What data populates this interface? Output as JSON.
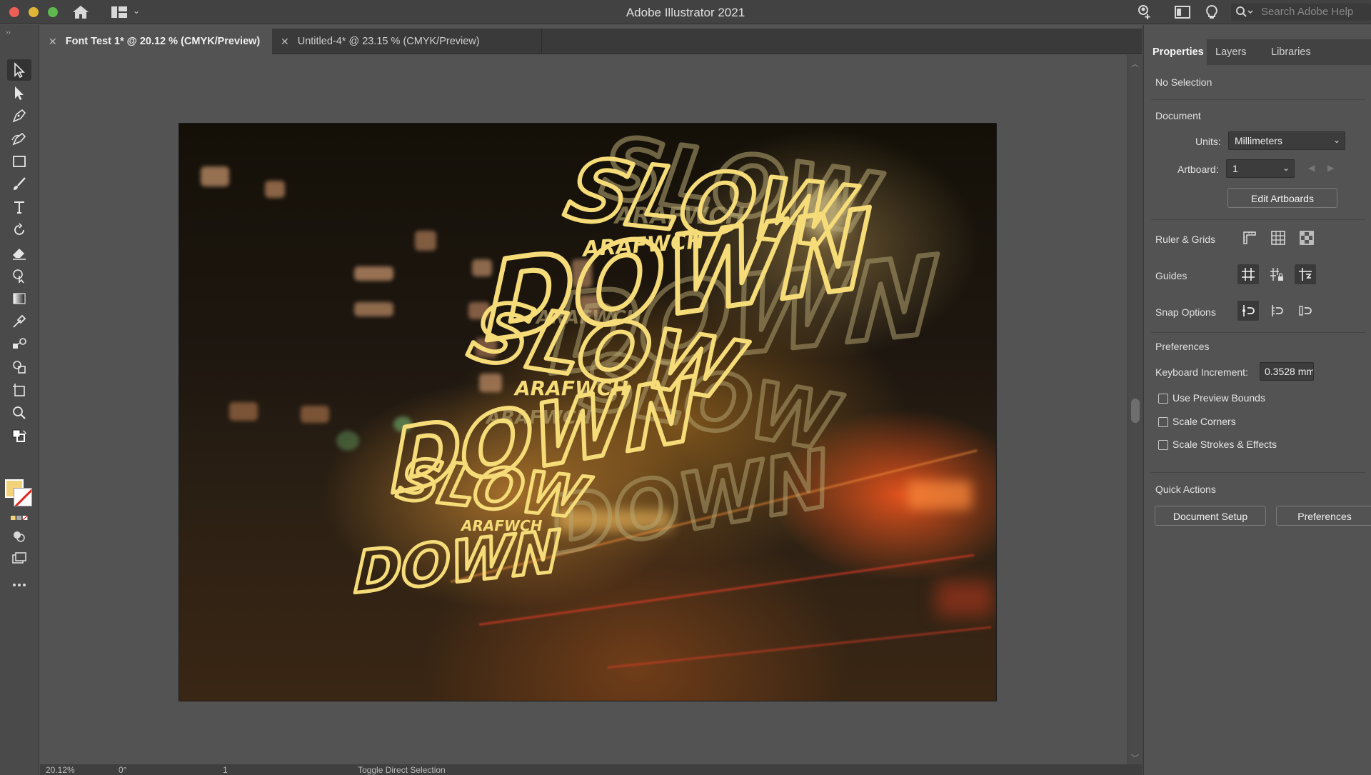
{
  "window": {
    "title": "Adobe Illustrator 2021"
  },
  "titlebar": {
    "search_placeholder": "Search Adobe Help"
  },
  "tabs": [
    {
      "label": "Font Test 1* @ 20.12 % (CMYK/Preview)",
      "active": true
    },
    {
      "label": "Untitled-4* @ 23.15 % (CMYK/Preview)",
      "active": false
    }
  ],
  "tools": [
    "selection-tool",
    "direct-selection-tool",
    "pen-tool",
    "curvature-tool",
    "rectangle-tool",
    "paintbrush-tool",
    "type-tool",
    "rotate-tool",
    "eraser-tool",
    "puppet-warp-tool",
    "gradient-tool",
    "eyedropper-tool",
    "blend-tool",
    "shape-builder-tool",
    "artboard-tool",
    "zoom-tool"
  ],
  "colors": {
    "fill": "#f3d37a",
    "stroke": "none",
    "accent": "#f3d37a"
  },
  "artwork": {
    "words": {
      "slow": "SLOW",
      "down": "DOWN",
      "arafwch": "ARAFWCH"
    }
  },
  "panel": {
    "tabs": [
      "Properties",
      "Layers",
      "Libraries"
    ],
    "selection": "No Selection",
    "document": {
      "header": "Document",
      "units_label": "Units:",
      "units_value": "Millimeters",
      "artboard_label": "Artboard:",
      "artboard_value": "1",
      "edit_artboards": "Edit Artboards"
    },
    "ruler_grids": "Ruler & Grids",
    "guides": "Guides",
    "snap_options": "Snap Options",
    "preferences": {
      "header": "Preferences",
      "keyboard_increment_label": "Keyboard Increment:",
      "keyboard_increment_value": "0.3528 mm",
      "checkboxes": [
        {
          "label": "Use Preview Bounds",
          "checked": false
        },
        {
          "label": "Scale Corners",
          "checked": false
        },
        {
          "label": "Scale Strokes & Effects",
          "checked": false
        }
      ]
    },
    "quick_actions": {
      "header": "Quick Actions",
      "document_setup": "Document Setup",
      "preferences": "Preferences"
    }
  },
  "statusbar": {
    "zoom": "20.12%",
    "rotation": "0°",
    "artboard": "1",
    "tool_hint": "Toggle Direct Selection"
  }
}
